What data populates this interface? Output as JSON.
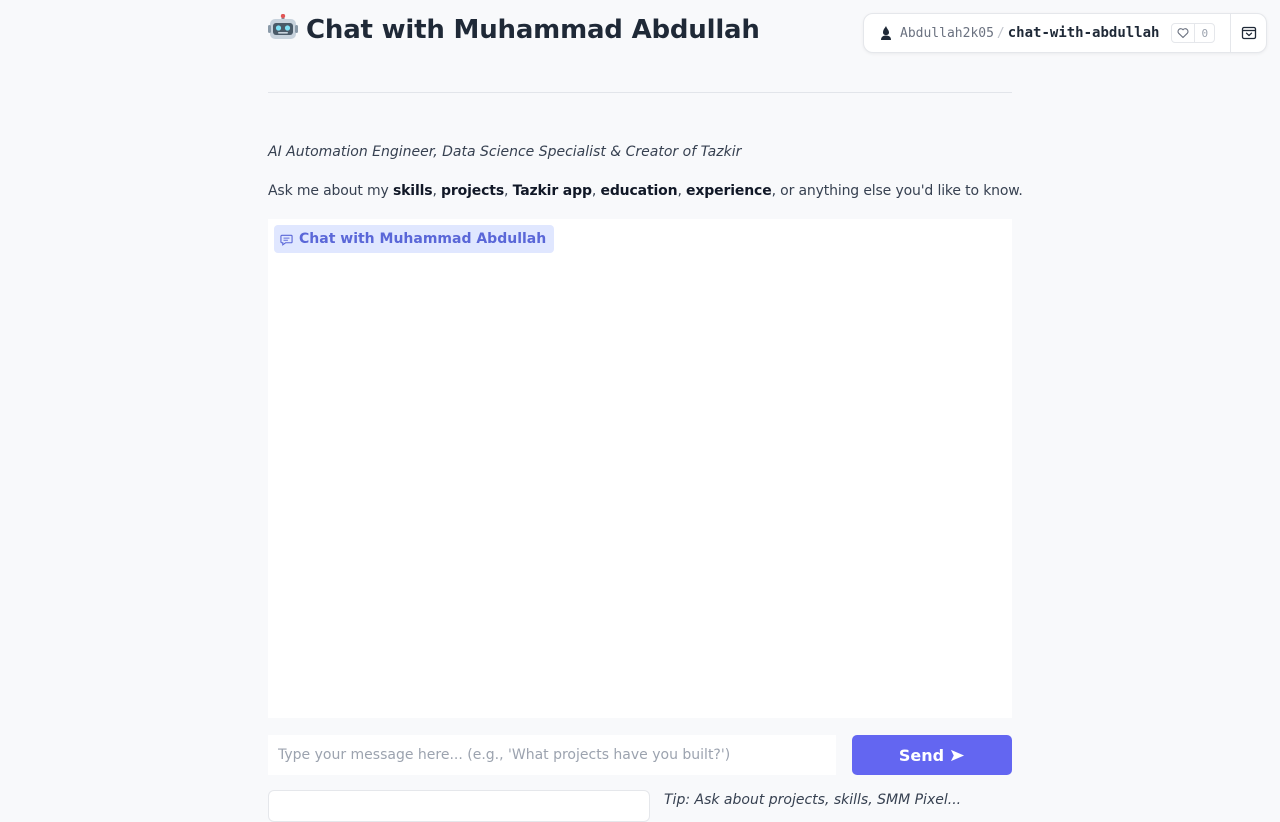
{
  "header": {
    "title": "Chat with Muhammad Abdullah",
    "subtitle": "AI Automation Engineer, Data Science Specialist & Creator of Tazkir"
  },
  "intro": {
    "prefix": "Ask me about my ",
    "topics": [
      "skills",
      "projects",
      "Tazkir app",
      "education",
      "experience"
    ],
    "sep": ", ",
    "suffix": ", or anything else you'd like to know."
  },
  "chatbot": {
    "label": "Chat with Muhammad Abdullah"
  },
  "input": {
    "value": "",
    "placeholder": "Type your message here... (e.g., 'What projects have you built?')"
  },
  "send": {
    "label": "Send"
  },
  "tip": {
    "text": "Tip: Ask about projects, skills, SMM Pixel..."
  },
  "space_badge": {
    "owner": "Abdullah2k05",
    "separator": "/",
    "name": "chat-with-abdullah",
    "likes": "0"
  },
  "icons": {
    "title": "robot-icon",
    "chat_label": "chat-bubble-icon",
    "send": "send-arrow-icon",
    "owner": "user-icon",
    "like": "heart-icon",
    "collapse": "collapse-icon"
  },
  "colors": {
    "accent": "#6366f1",
    "label_bg": "#e0e7ff",
    "label_text": "#5a67d8",
    "background": "#f8f9fb"
  }
}
